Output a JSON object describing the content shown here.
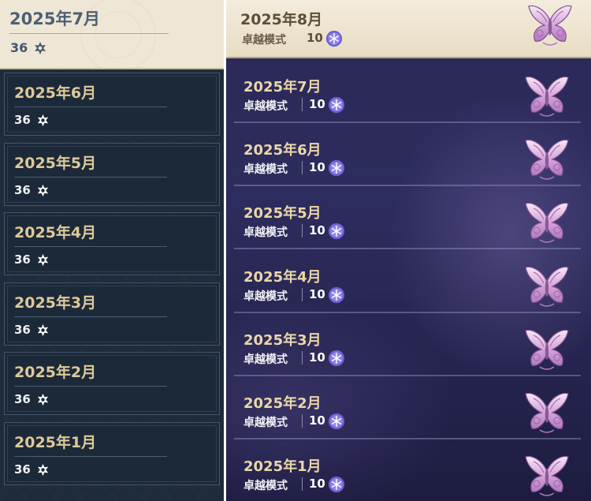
{
  "left_panel": {
    "selected": {
      "title": "2025年7月",
      "count": "36"
    },
    "items": [
      {
        "title": "2025年6月",
        "count": "36"
      },
      {
        "title": "2025年5月",
        "count": "36"
      },
      {
        "title": "2025年4月",
        "count": "36"
      },
      {
        "title": "2025年3月",
        "count": "36"
      },
      {
        "title": "2025年2月",
        "count": "36"
      },
      {
        "title": "2025年1月",
        "count": "36"
      }
    ]
  },
  "right_panel": {
    "selected": {
      "title": "2025年8月",
      "mode": "卓越模式",
      "count": "10"
    },
    "items": [
      {
        "title": "2025年7月",
        "mode": "卓越模式",
        "count": "10"
      },
      {
        "title": "2025年6月",
        "mode": "卓越模式",
        "count": "10"
      },
      {
        "title": "2025年5月",
        "mode": "卓越模式",
        "count": "10"
      },
      {
        "title": "2025年4月",
        "mode": "卓越模式",
        "count": "10"
      },
      {
        "title": "2025年3月",
        "mode": "卓越模式",
        "count": "10"
      },
      {
        "title": "2025年2月",
        "mode": "卓越模式",
        "count": "10"
      },
      {
        "title": "2025年1月",
        "mode": "卓越模式",
        "count": "10"
      }
    ]
  },
  "icons": {
    "star": "six-point-star-icon",
    "medal": "snowflake-medal-icon",
    "butterfly": "butterfly-emblem-icon"
  },
  "colors": {
    "left_bg": "#1f2b3a",
    "left_title": "#ddc99a",
    "selected_bg": "#efe7d6",
    "right_bg": "#2a2957",
    "right_title": "#ead7a8"
  }
}
